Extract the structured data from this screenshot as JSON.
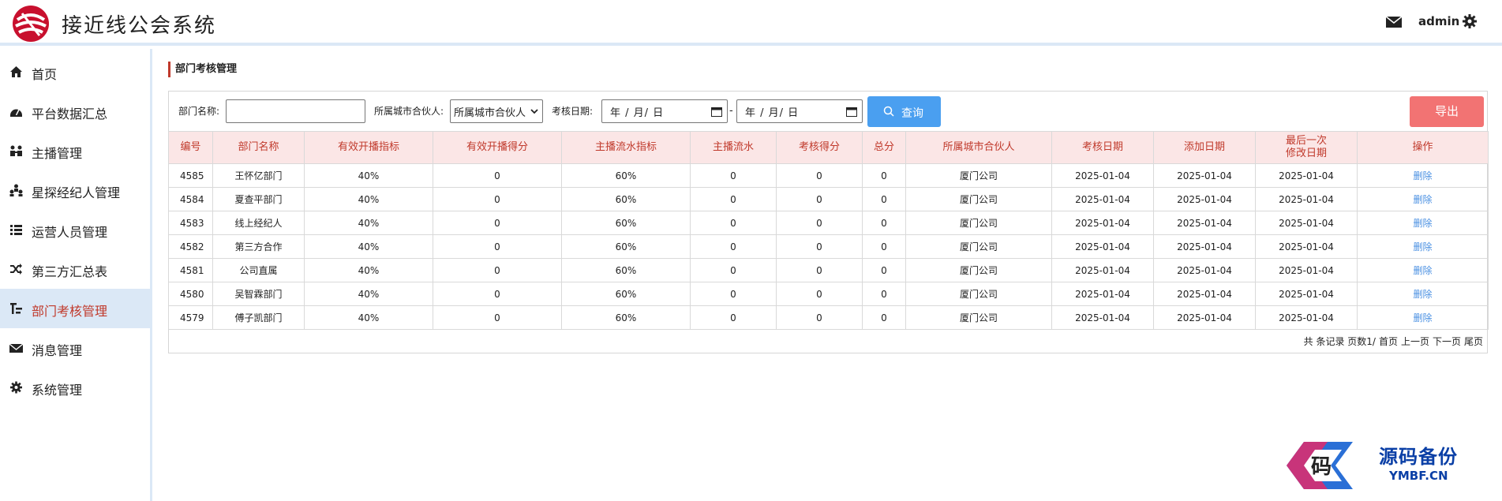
{
  "header": {
    "app_title": "接近线公会系统",
    "user": "admin"
  },
  "sidebar": {
    "items": [
      {
        "label": "首页",
        "icon": "home-icon"
      },
      {
        "label": "平台数据汇总",
        "icon": "dashboard-icon"
      },
      {
        "label": "主播管理",
        "icon": "streamer-icon"
      },
      {
        "label": "星探经纪人管理",
        "icon": "team-icon"
      },
      {
        "label": "运营人员管理",
        "icon": "list-icon"
      },
      {
        "label": "第三方汇总表",
        "icon": "shuffle-icon"
      },
      {
        "label": "部门考核管理",
        "icon": "sliders-icon",
        "active": true
      },
      {
        "label": "消息管理",
        "icon": "mail-icon"
      },
      {
        "label": "系统管理",
        "icon": "gear-icon"
      }
    ]
  },
  "page": {
    "title": "部门考核管理"
  },
  "filters": {
    "dept_label": "部门名称:",
    "dept_value": "",
    "partner_label": "所属城市合伙人:",
    "partner_selected": "所属城市合伙人",
    "date_label": "考核日期:",
    "date_start": "年 / 月/ 日",
    "date_end": "年 / 月/ 日",
    "date_separator": "-",
    "query_label": "查询",
    "export_label": "导出"
  },
  "table": {
    "columns": [
      "编号",
      "部门名称",
      "有效开播指标",
      "有效开播得分",
      "主播流水指标",
      "主播流水",
      "考核得分",
      "总分",
      "所属城市合伙人",
      "考核日期",
      "添加日期",
      "最后一次\n修改日期",
      "操作"
    ],
    "rows": [
      [
        "4585",
        "王怀亿部门",
        "40%",
        "0",
        "60%",
        "0",
        "0",
        "0",
        "厦门公司",
        "2025-01-04",
        "2025-01-04",
        "2025-01-04",
        "删除"
      ],
      [
        "4584",
        "夏查平部门",
        "40%",
        "0",
        "60%",
        "0",
        "0",
        "0",
        "厦门公司",
        "2025-01-04",
        "2025-01-04",
        "2025-01-04",
        "删除"
      ],
      [
        "4583",
        "线上经纪人",
        "40%",
        "0",
        "60%",
        "0",
        "0",
        "0",
        "厦门公司",
        "2025-01-04",
        "2025-01-04",
        "2025-01-04",
        "删除"
      ],
      [
        "4582",
        "第三方合作",
        "40%",
        "0",
        "60%",
        "0",
        "0",
        "0",
        "厦门公司",
        "2025-01-04",
        "2025-01-04",
        "2025-01-04",
        "删除"
      ],
      [
        "4581",
        "公司直属",
        "40%",
        "0",
        "60%",
        "0",
        "0",
        "0",
        "厦门公司",
        "2025-01-04",
        "2025-01-04",
        "2025-01-04",
        "删除"
      ],
      [
        "4580",
        "吴智霖部门",
        "40%",
        "0",
        "60%",
        "0",
        "0",
        "0",
        "厦门公司",
        "2025-01-04",
        "2025-01-04",
        "2025-01-04",
        "删除"
      ],
      [
        "4579",
        "傅子凯部门",
        "40%",
        "0",
        "60%",
        "0",
        "0",
        "0",
        "厦门公司",
        "2025-01-04",
        "2025-01-04",
        "2025-01-04",
        "删除"
      ]
    ]
  },
  "pager": {
    "summary": "共 条记录 页数1/",
    "first": "首页",
    "prev": "上一页",
    "next": "下一页",
    "last": "尾页"
  },
  "watermark": {
    "cn": "源码备份",
    "en": "YMBF.CN",
    "glyph": "码"
  },
  "colors": {
    "accent_red": "#c0392b",
    "query_blue": "#4a9ff0",
    "export_red": "#f27373",
    "header_pink": "#fbe6e6",
    "active_nav": "#dbe8f6",
    "link_blue": "#4a90e2"
  }
}
